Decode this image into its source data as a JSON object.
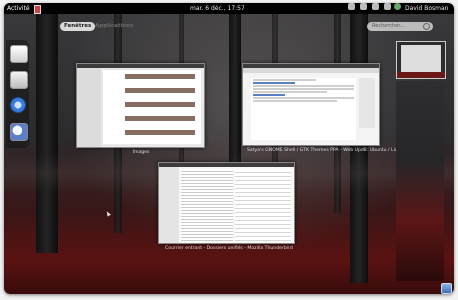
{
  "topbar": {
    "activities_label": "Activité",
    "clock": "mar. 6 déc., 17:57",
    "user_name": "David Bosman"
  },
  "overview_tabs": [
    {
      "label": "Fenêtres",
      "active": true
    },
    {
      "label": "Applications",
      "active": false
    }
  ],
  "search": {
    "placeholder": "Rechercher..."
  },
  "windows": [
    {
      "caption": "Images"
    },
    {
      "caption": "Satya's GNOME Shell / GTK Themes PPA - Web Upd8: Ubuntu / Lin..."
    },
    {
      "caption": "Courrier entrant - Dossiers unifiés - Mozilla Thunderbird"
    }
  ],
  "dash_icons": [
    "text-editor-icon",
    "file-manager-icon",
    "chromium-icon",
    "thunderbird-icon"
  ],
  "colors": {
    "topbar": "#000000",
    "tab_active": "#d9d9d9"
  }
}
